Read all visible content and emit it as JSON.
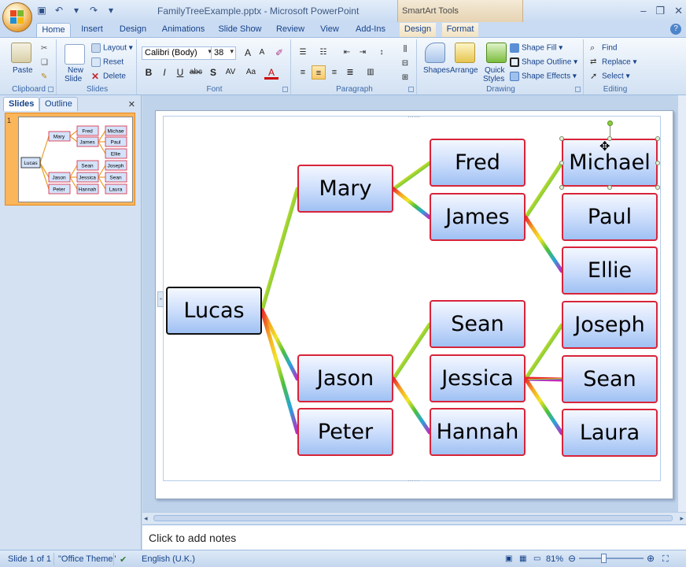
{
  "app": {
    "window_title": "FamilyTreeExample.pptx - Microsoft PowerPoint",
    "contextual_tab_group": "SmartArt Tools"
  },
  "tabs": [
    "Home",
    "Insert",
    "Design",
    "Animations",
    "Slide Show",
    "Review",
    "View",
    "Add-Ins",
    "Design",
    "Format"
  ],
  "ribbon": {
    "clipboard": {
      "label": "Clipboard",
      "paste": "Paste"
    },
    "slides": {
      "label": "Slides",
      "new_slide_line1": "New",
      "new_slide_line2": "Slide",
      "layout": "Layout",
      "reset": "Reset",
      "delete": "Delete"
    },
    "font": {
      "label": "Font",
      "font_name": "Calibri (Body)",
      "font_size": "38"
    },
    "paragraph": {
      "label": "Paragraph"
    },
    "drawing": {
      "label": "Drawing",
      "shapes": "Shapes",
      "arrange": "Arrange",
      "quick_styles_1": "Quick",
      "quick_styles_2": "Styles",
      "shape_fill": "Shape Fill",
      "shape_outline": "Shape Outline",
      "shape_effects": "Shape Effects"
    },
    "editing": {
      "label": "Editing",
      "find": "Find",
      "replace": "Replace",
      "select": "Select"
    }
  },
  "left_panel": {
    "tab_slides": "Slides",
    "tab_outline": "Outline",
    "slide_number": "1"
  },
  "family_tree": {
    "root": "Lucas",
    "gen1": [
      "Mary",
      "Jason",
      "Peter"
    ],
    "gen2": [
      "Fred",
      "James",
      "Sean",
      "Jessica",
      "Hannah"
    ],
    "gen3": [
      "Michael",
      "Paul",
      "Ellie",
      "Joseph",
      "Sean",
      "Laura"
    ]
  },
  "notes": {
    "placeholder": "Click to add notes"
  },
  "status": {
    "slide_info": "Slide 1 of 1",
    "theme": "\"Office Theme\"",
    "language": "English (U.K.)",
    "zoom": "81%"
  },
  "colors": {
    "node_border": "#d8243a",
    "root_border": "#111111",
    "ribbon_accent": "#15428b"
  }
}
